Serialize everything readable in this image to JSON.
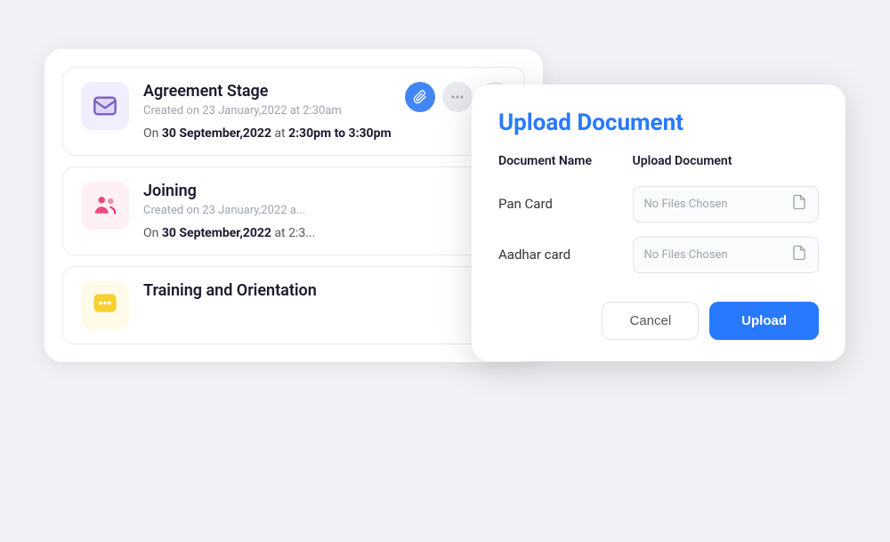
{
  "cards": [
    {
      "id": "agreement",
      "title": "Agreement Stage",
      "subtitle": "Created on 23 January,2022 at 2:30am",
      "date_line": "On",
      "date_bold": "30 September,2022",
      "date_suffix": "at",
      "time_bold": "2:30pm to 3:30pm",
      "icon": "envelope",
      "icon_bg": "purple",
      "actions": [
        {
          "label": "📎",
          "style": "blue"
        },
        {
          "label": "•••",
          "style": "gray"
        },
        {
          "label": "•••",
          "style": "gray"
        }
      ]
    },
    {
      "id": "joining",
      "title": "Joining",
      "subtitle": "Created on 23 January,2022 a...",
      "date_line": "On",
      "date_bold": "30 September,2022",
      "date_suffix": "at 2:3...",
      "time_bold": "",
      "icon": "people",
      "icon_bg": "pink"
    },
    {
      "id": "training",
      "title": "Training and Orientation",
      "subtitle": "",
      "date_line": "",
      "date_bold": "",
      "date_suffix": "",
      "time_bold": "",
      "icon": "chat",
      "icon_bg": "yellow"
    }
  ],
  "dialog": {
    "title": "Upload Document",
    "col_name": "Document Name",
    "col_upload": "Upload Document",
    "rows": [
      {
        "name": "Pan Card",
        "placeholder": "No Files Chosen"
      },
      {
        "name": "Aadhar card",
        "placeholder": "No Files Chosen"
      }
    ],
    "cancel_label": "Cancel",
    "upload_label": "Upload"
  }
}
